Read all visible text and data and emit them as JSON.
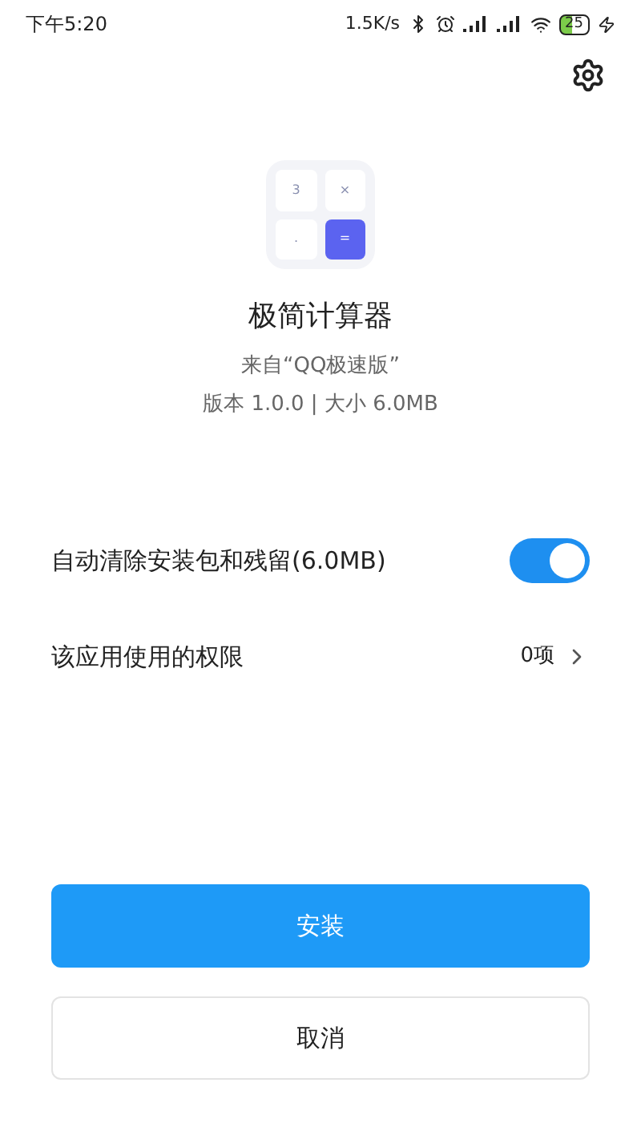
{
  "status_bar": {
    "time": "下午5:20",
    "speed": "1.5K/s",
    "battery": "25"
  },
  "app": {
    "icon_keys": [
      "3",
      "×",
      ".",
      "="
    ],
    "name": "极简计算器",
    "source": "来自“QQ极速版”",
    "info": "版本 1.0.0 | 大小 6.0MB"
  },
  "settings": [
    {
      "kind": "toggle",
      "label": "自动清除安装包和残留(6.0MB)",
      "on": true
    },
    {
      "kind": "link",
      "label": "该应用使用的权限",
      "value": "0项"
    }
  ],
  "buttons": [
    {
      "label": "安装",
      "kind": "primary"
    },
    {
      "label": "取消",
      "kind": "secondary"
    }
  ]
}
